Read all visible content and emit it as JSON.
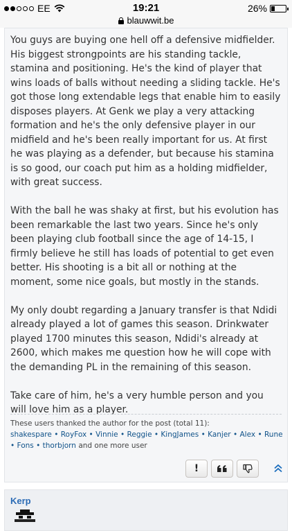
{
  "status_bar": {
    "carrier": "EE",
    "time": "19:21",
    "battery": "26%",
    "battery_level": 0.26,
    "url": "blauwwit.be"
  },
  "post": {
    "paragraphs": [
      "You guys are buying one hell off a defensive midfielder. His biggest strongpoints are his standing tackle, stamina and positioning. He's the kind of player that wins loads of balls without needing a sliding tackle. He's got those long extendable legs that enable him to easily disposes players. At Genk we play a very attacking formation and he's the only defensive player in our midfield and he's been really important for us. At first he was playing as a defender, but because his stamina is so good, our coach put him as a holding midfielder, with great success.",
      "With the ball he was shaky at first, but his evolution has been remarkable the last two years. Since he's only been playing club football since the age of 14-15, I firmly believe he still has loads of potential to get even better. His shooting is a bit all or nothing at the moment, some nice goals, but mostly in the stands.",
      "My only doubt regarding a January transfer is that Ndidi already played a lot of games this season. Drinkwater played 1700 minutes this season, Ndidi's already at 2600, which makes me question how he will cope with the demanding PL in the remaining of this season.",
      "Take care of him, he's a very humble person and you will love him as a player."
    ],
    "thanks_heading": "These users thanked the author for the post (total 11):",
    "thanks_users": [
      "shakespare",
      "RoyFox",
      "Vinnie",
      "Reggie",
      "KingJames",
      "Kanjer",
      "Alex",
      "Rune",
      "Fons",
      "thorbjorn"
    ],
    "thanks_tail": "and one more user",
    "actions": {
      "report_label": "!",
      "quote_label": "“"
    }
  },
  "next_post": {
    "author": "Kerp"
  }
}
